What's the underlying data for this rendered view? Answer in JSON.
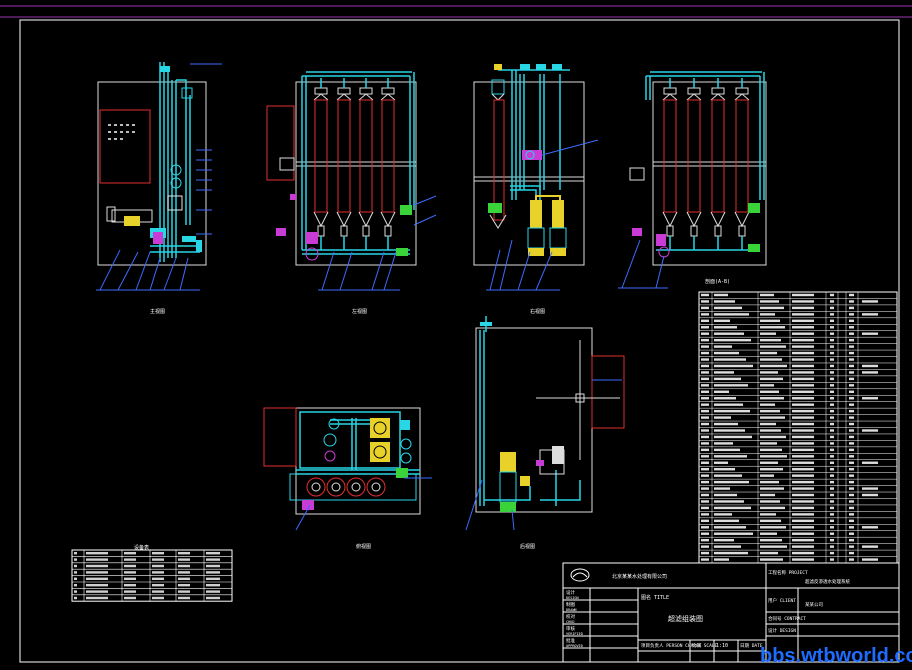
{
  "drawing": {
    "views": {
      "v1": "主视图",
      "v2": "左视图",
      "v3": "右视图",
      "v4": "剖面(A-B)",
      "v5": "俯视图",
      "v6": "后视图"
    },
    "small_table_title": "设备表"
  },
  "title_block": {
    "company": "北京某某水处理有限公司",
    "title_label": "图名 TITLE",
    "title_value": "超滤组装图",
    "project_label": "工程名称 PROJECT",
    "project_value": "超滤反渗透水处理系统",
    "client_label": "用户 CLIENT",
    "client_value": "某某公司",
    "contract_label": "合同号 CONTRACT",
    "design_label": "设计 DESIGN",
    "left_rows": [
      "设计",
      "DESIGN",
      "制图",
      "DRAWN",
      "校对",
      "CHKD",
      "审核",
      "VERIFIED",
      "批准",
      "APPROVED"
    ],
    "person_label": "项目负责人 PERSON CHARGE",
    "scale_label": "比例 SCALE",
    "scale_value": "1:10",
    "date_label": "日期 DATE"
  },
  "watermark": "bbs.wtbworld.com"
}
